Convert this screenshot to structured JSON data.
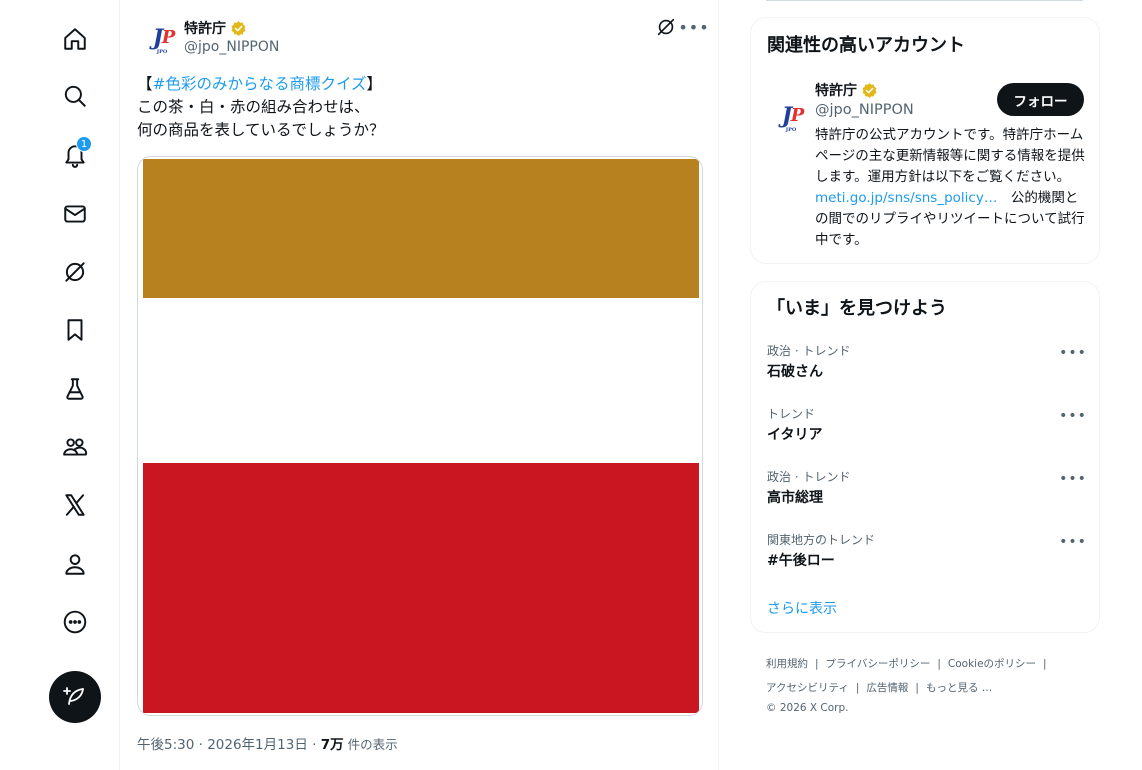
{
  "nav": {
    "notification_count": "1"
  },
  "tweet": {
    "author_name": "特許庁",
    "author_handle": "@jpo_NIPPON",
    "text_open_bracket": "【",
    "hashtag": "#色彩のみからなる商標クイズ",
    "text_close_bracket": "】",
    "line2": "この茶・白・赤の組み合わせは、",
    "line3": "何の商品を表しているでしょうか？",
    "meta_time": "午後5:30 · 2026年1月13日 · ",
    "meta_views": "7万",
    "meta_views_unit": " 件の表示",
    "image_colors": {
      "top": "#b8811f",
      "middle": "#ffffff",
      "bottom": "#c91620"
    }
  },
  "related": {
    "title": "関連性の高いアカウント",
    "name": "特許庁",
    "handle": "@jpo_NIPPON",
    "follow_label": "フォロー",
    "bio_part1": "特許庁の公式アカウントです。特許庁ホームページの主な更新情報等に関する情報を提供します。運用方針は以下をご覧ください。",
    "bio_link": "meti.go.jp/sns/sns_policy…",
    "bio_part2": "　公的機関との間でのリプライやリツイートについて試行中です。"
  },
  "trends": {
    "title": "「いま」を見つけよう",
    "items": [
      {
        "category": "政治 · トレンド",
        "title": "石破さん"
      },
      {
        "category": "トレンド",
        "title": "イタリア"
      },
      {
        "category": "政治 · トレンド",
        "title": "高市総理"
      },
      {
        "category": "関東地方のトレンド",
        "title": "#午後ロー"
      }
    ],
    "show_more": "さらに表示"
  },
  "footer": {
    "terms": "利用規約",
    "privacy": "プライバシーポリシー",
    "cookie": "Cookieのポリシー",
    "accessibility": "アクセシビリティ",
    "ads": "広告情報",
    "more": "もっと見る …",
    "copyright": "© 2026 X Corp."
  },
  "colors": {
    "accent": "#1d9bf0",
    "verified_gold": "#e2b719"
  }
}
